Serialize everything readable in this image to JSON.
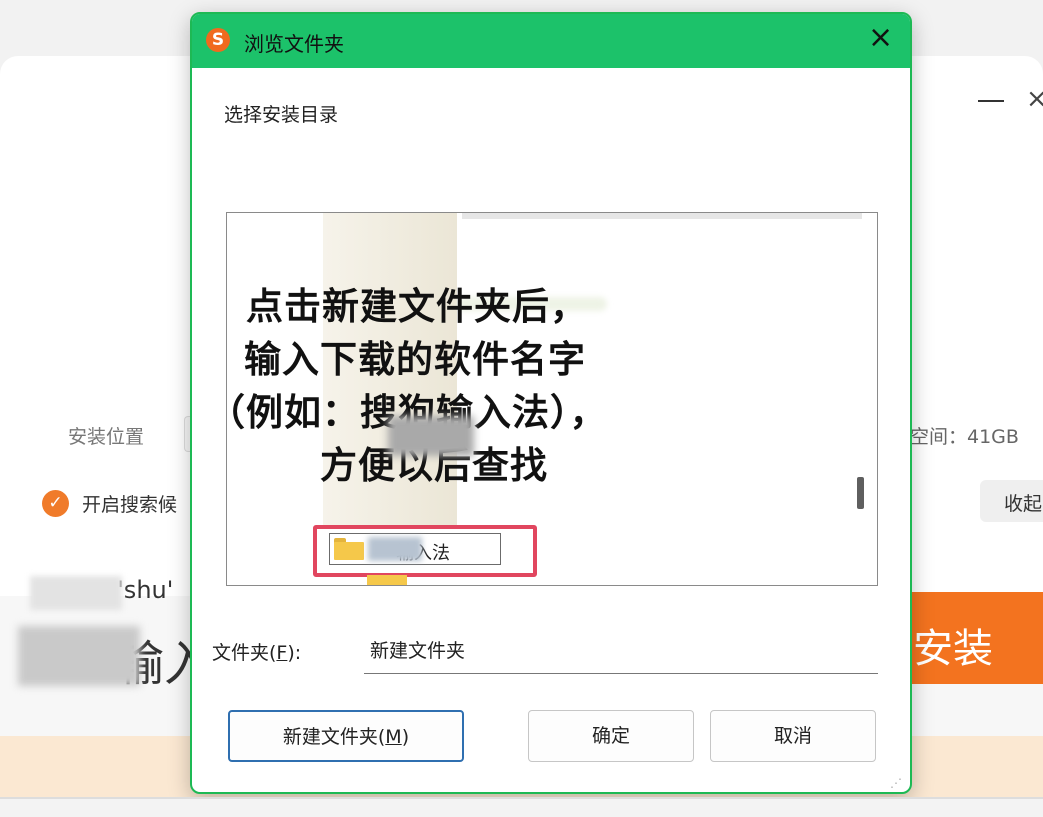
{
  "installer": {
    "install_location_label": "安装位置",
    "free_space_label": "空间：41GB",
    "search_option_label": "开启搜索候",
    "collapse_button": "收起",
    "pinyin_fragment": "u'shu'",
    "brand_fragment": "输入",
    "install_button": "安装",
    "minimize_icon": "minimize-icon",
    "close_icon": "close-icon"
  },
  "dialog": {
    "title": "浏览文件夹",
    "instruction": "选择安装目录",
    "folder_item": "输入法",
    "folder_field_label_pre": "文件夹(",
    "folder_field_label_key": "F",
    "folder_field_label_post": "):",
    "folder_input_value": "新建文件夹",
    "new_folder_button_pre": "新建文件夹(",
    "new_folder_button_key": "M",
    "new_folder_button_post": ")",
    "ok_button": "确定",
    "cancel_button": "取消"
  },
  "annotation": {
    "line1": "点击新建文件夹后，",
    "line2": "输入下载的软件名字",
    "line3": "（例如：搜狗输入法），",
    "line4": "方便以后查找"
  },
  "colors": {
    "title_bar": "#1cc26a",
    "install_button": "#f3731f",
    "highlight_box": "#e1465f",
    "check": "#f07b2a"
  }
}
